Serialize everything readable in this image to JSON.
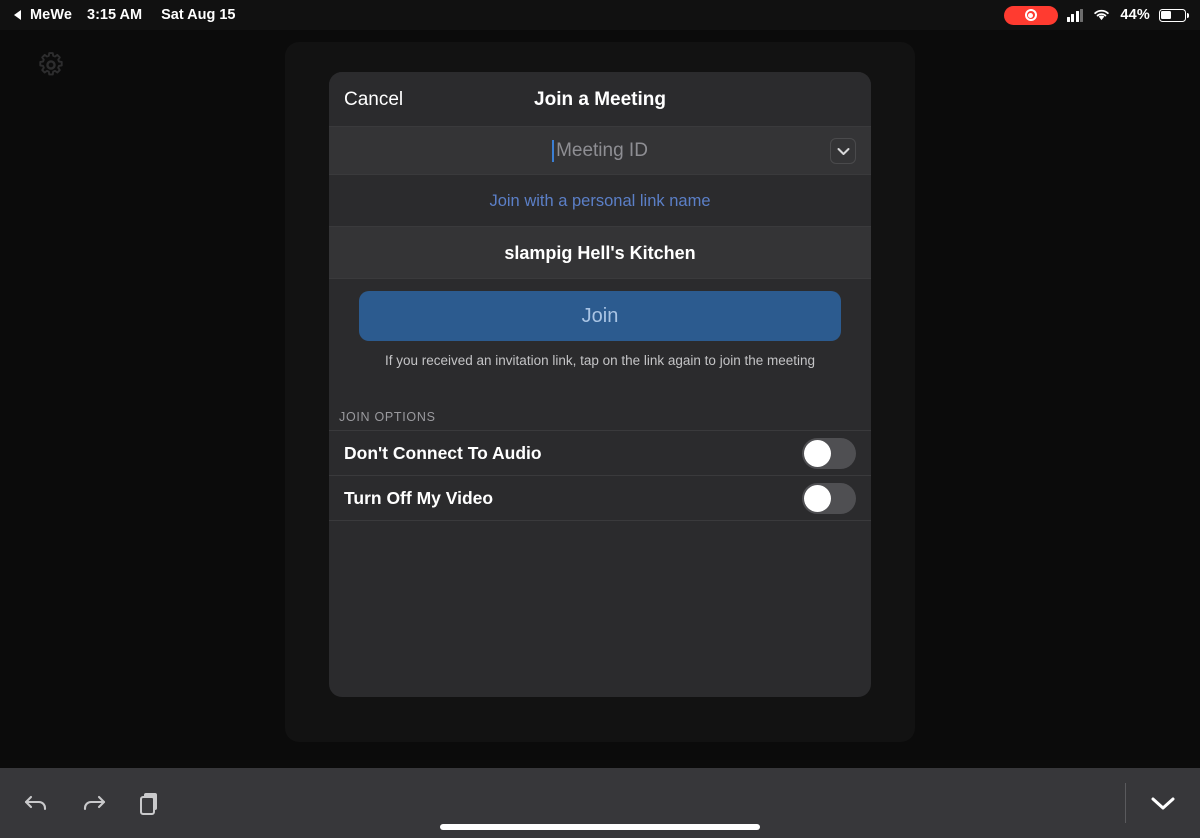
{
  "status_bar": {
    "back_arrow_icon": "back-triangle-icon",
    "back_app": "MeWe",
    "time": "3:15 AM",
    "date": "Sat Aug 15",
    "recording_icon": "screen-recording-icon",
    "cellular_icon": "cellular-signal-icon",
    "wifi_icon": "wifi-icon",
    "battery_percent": "44%",
    "battery_icon": "battery-icon"
  },
  "backdrop": {
    "settings_icon": "gear-icon"
  },
  "modal": {
    "cancel_label": "Cancel",
    "title": "Join a Meeting",
    "meeting_id": {
      "value": "",
      "placeholder": "Meeting ID",
      "dropdown_icon": "chevron-down-icon"
    },
    "personal_link_label": "Join with a personal link name",
    "display_name": "slampig Hell's Kitchen",
    "join_button_label": "Join",
    "join_hint": "If you received an invitation link, tap on the link again to join the meeting",
    "options_section_title": "JOIN OPTIONS",
    "options": [
      {
        "label": "Don't Connect To Audio",
        "enabled": false
      },
      {
        "label": "Turn Off My Video",
        "enabled": false
      }
    ]
  },
  "toolbar": {
    "undo_icon": "undo-icon",
    "redo_icon": "redo-icon",
    "paste_icon": "paste-icon",
    "dismiss_icon": "chevron-down-icon"
  },
  "colors": {
    "accent_blue": "#5b7fc7",
    "join_button_bg": "#2c5b8f",
    "join_button_text": "#a9c4e4",
    "modal_bg": "#2b2b2d",
    "row_alt_bg": "#343436",
    "recording_red": "#ff3b30",
    "caret_blue": "#3b7fd4"
  }
}
